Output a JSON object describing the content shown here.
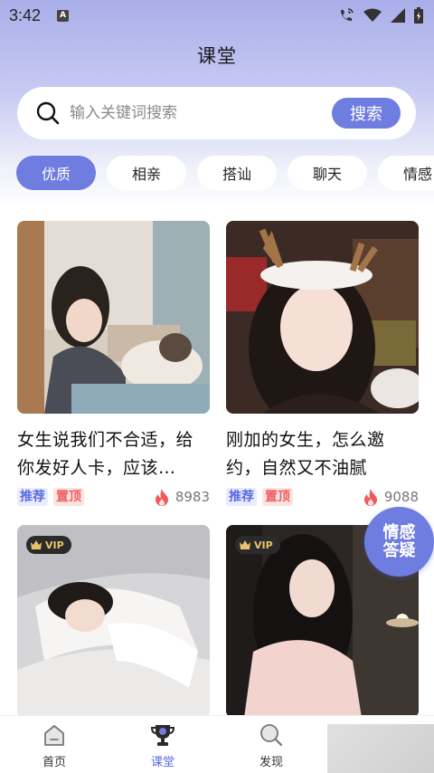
{
  "status": {
    "time": "3:42",
    "indicator": "A"
  },
  "header": {
    "title": "课堂"
  },
  "search": {
    "placeholder": "输入关键词搜索",
    "button_label": "搜索"
  },
  "tabs": [
    {
      "label": "优质",
      "active": true
    },
    {
      "label": "相亲",
      "active": false
    },
    {
      "label": "搭讪",
      "active": false
    },
    {
      "label": "聊天",
      "active": false
    },
    {
      "label": "情感",
      "active": false
    }
  ],
  "cards": [
    {
      "title": "女生说我们不合适，给你发好人卡，应该…",
      "tags": [
        "推荐",
        "置顶"
      ],
      "hot_count": "8983",
      "vip": false
    },
    {
      "title": "刚加的女生，怎么邀约，自然又不油腻",
      "tags": [
        "推荐",
        "置顶"
      ],
      "hot_count": "9088",
      "vip": false
    },
    {
      "title": "",
      "tags": [],
      "hot_count": "",
      "vip": true,
      "vip_label": "VIP"
    },
    {
      "title": "",
      "tags": [],
      "hot_count": "",
      "vip": true,
      "vip_label": "VIP"
    }
  ],
  "float_button": {
    "line1": "情感",
    "line2": "答疑"
  },
  "bottom_nav": [
    {
      "label": "首页",
      "icon": "home-icon",
      "active": false
    },
    {
      "label": "课堂",
      "icon": "trophy-icon",
      "active": true
    },
    {
      "label": "发现",
      "icon": "discover-icon",
      "active": false
    }
  ],
  "colors": {
    "accent": "#6f7ce0",
    "tag_red": "#f05a5a",
    "hot": "#f25a5a"
  }
}
